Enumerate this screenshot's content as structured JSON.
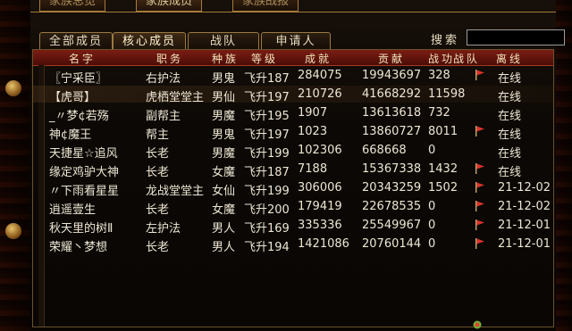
{
  "main_tabs": [
    "家族总览",
    "家族成员",
    "家族战报"
  ],
  "sub_tabs": [
    "全部成员",
    "核心成员",
    "战队",
    "申请人"
  ],
  "search": {
    "label": "搜索",
    "value": ""
  },
  "columns": [
    "名字",
    "职务",
    "种族",
    "等级",
    "成就",
    "贡献",
    "战功",
    "战队",
    "离线"
  ],
  "members": [
    {
      "name": "〖宁采臣〗",
      "role": "右护法",
      "race": "男鬼",
      "level": "飞升187",
      "achievement": "284075",
      "contribution": "19943697",
      "merit": "328",
      "team": "flag",
      "offline": "在线"
    },
    {
      "name": "【虎哥】",
      "role": "虎栖堂堂主",
      "race": "男仙",
      "level": "飞升197",
      "achievement": "210726",
      "contribution": "41668292",
      "merit": "11598",
      "team": "",
      "offline": "在线"
    },
    {
      "name": "_〃梦¢若殇",
      "role": "副帮主",
      "race": "男魔",
      "level": "飞升195",
      "achievement": "1907",
      "contribution": "13613618",
      "merit": "732",
      "team": "",
      "offline": "在线"
    },
    {
      "name": "神¢魔王",
      "role": "帮主",
      "race": "男鬼",
      "level": "飞升197",
      "achievement": "1023",
      "contribution": "13860727",
      "merit": "8011",
      "team": "flag",
      "offline": "在线"
    },
    {
      "name": "天捷星☆追风",
      "role": "长老",
      "race": "男魔",
      "level": "飞升199",
      "achievement": "102306",
      "contribution": "668668",
      "merit": "0",
      "team": "",
      "offline": "在线"
    },
    {
      "name": "缘定鸡驴大神",
      "role": "长老",
      "race": "女魔",
      "level": "飞升187",
      "achievement": "7188",
      "contribution": "15367338",
      "merit": "1432",
      "team": "flag",
      "offline": "在线"
    },
    {
      "name": "〃下雨看星星",
      "role": "龙战堂堂主",
      "race": "女仙",
      "level": "飞升199",
      "achievement": "306006",
      "contribution": "20343259",
      "merit": "1502",
      "team": "flag",
      "offline": "21-12-02"
    },
    {
      "name": "逍遥壹生",
      "role": "长老",
      "race": "女魔",
      "level": "飞升200",
      "achievement": "179419",
      "contribution": "22678535",
      "merit": "0",
      "team": "flag",
      "offline": "21-12-02"
    },
    {
      "name": "秋天里的树Ⅱ",
      "role": "左护法",
      "race": "男人",
      "level": "飞升169",
      "achievement": "335336",
      "contribution": "25549967",
      "merit": "0",
      "team": "flag",
      "offline": "21-12-01"
    },
    {
      "name": "荣耀丶梦想",
      "role": "长老",
      "race": "男人",
      "level": "飞升194",
      "achievement": "1421086",
      "contribution": "20760144",
      "merit": "0",
      "team": "flag",
      "offline": "21-12-01"
    }
  ],
  "colors": {
    "header_bg": "#7a1d14",
    "flag": "#d9342a",
    "frame": "#a57c39"
  }
}
